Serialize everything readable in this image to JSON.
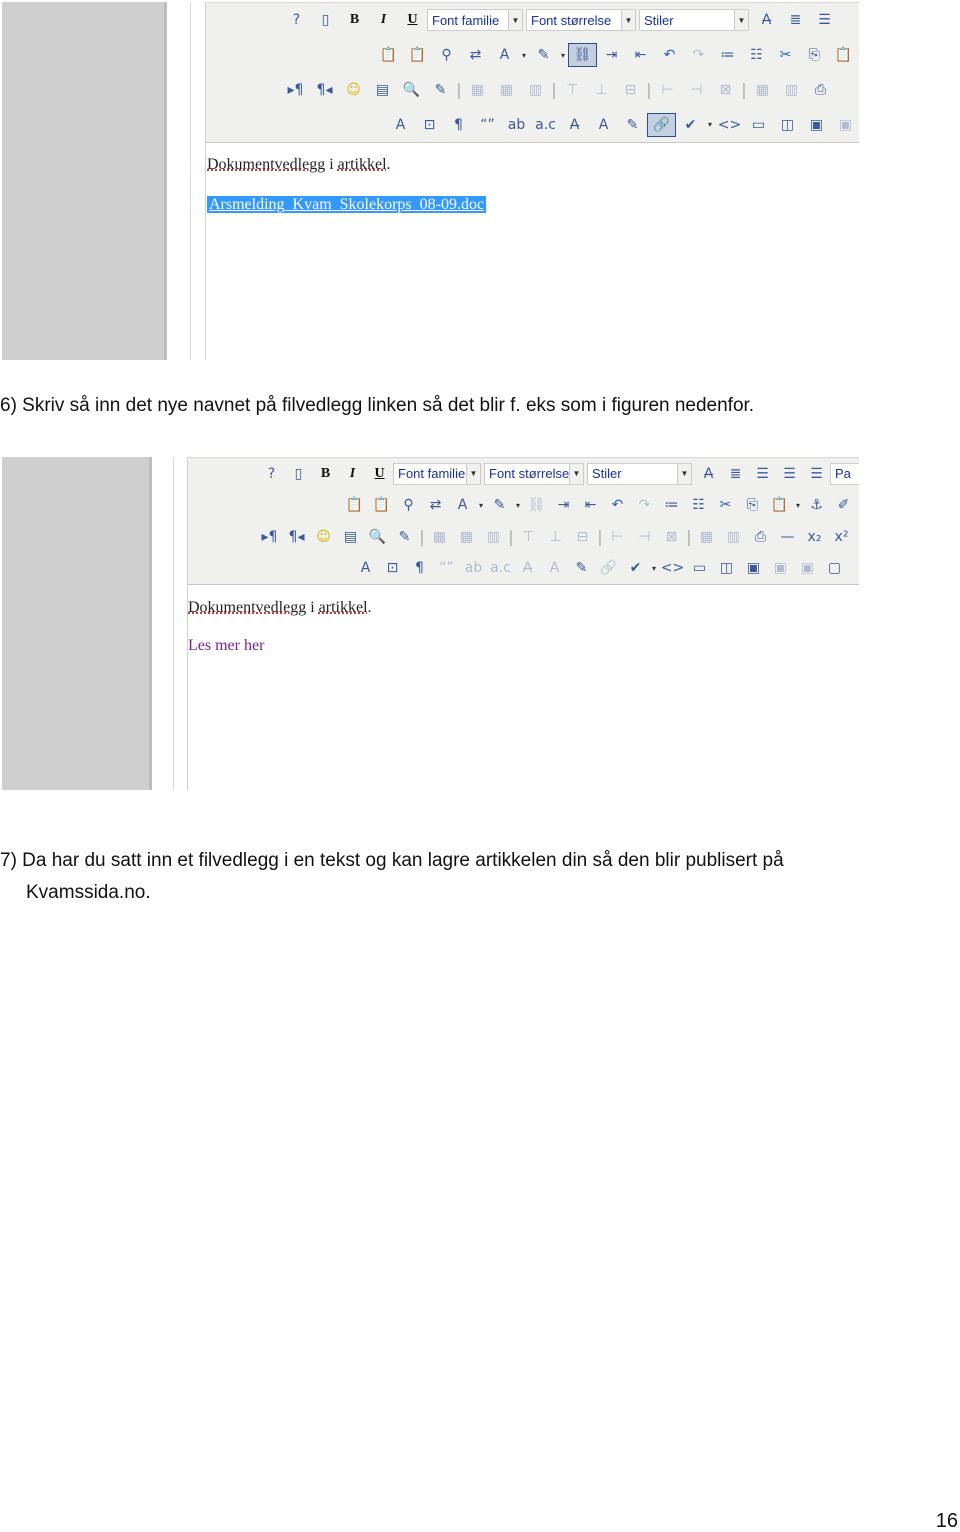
{
  "screenshot1": {
    "toolbar": {
      "font_family": "Font familie",
      "font_size": "Font størrelse",
      "styles": "Stiler",
      "rows": [
        [
          "help",
          "new-document",
          "bold",
          "italic",
          "underline",
          "SELECTS",
          "strikethrough-abc",
          "justify-full",
          "align-center"
        ],
        [
          "paste-word",
          "paste-text",
          "find",
          "replace",
          "text-color",
          "dropdown",
          "highlight-color",
          "dropdown",
          "unlink-active",
          "indent",
          "outdent",
          "undo",
          "redo-disabled",
          "ordered-list",
          "unordered-list",
          "cut",
          "copy",
          "paste"
        ],
        [
          "ltr",
          "rtl",
          "emoticon",
          "template",
          "preview",
          "edit-document",
          "separator",
          "row-props-disabled",
          "cell-props-disabled",
          "merge-disabled",
          "separator",
          "row-before-disabled",
          "row-after-disabled",
          "delete-row-disabled",
          "separator",
          "col-before-disabled",
          "col-after-disabled",
          "delete-col-disabled",
          "separator",
          "table-disabled",
          "split-disabled",
          "print"
        ],
        [
          "styleprops",
          "insert-layer",
          "pilcrow",
          "cite",
          "abbr",
          "acronym",
          "del",
          "ins",
          "attribs",
          "link-active",
          "spellcheck",
          "dropdown",
          "code",
          "layer",
          "columns",
          "image",
          "image-disabled"
        ]
      ]
    },
    "content": {
      "line1_word1": "Dokumentvedlegg",
      "line1_word2": "i",
      "line1_word3": "artikkel",
      "line1_end": ".",
      "link_text": "Arsmelding_Kvam_Skolekorps_08-09.doc"
    }
  },
  "caption6": "6) Skriv så inn det nye navnet på filvedlegg linken så det blir f. eks som i figuren nedenfor.",
  "screenshot2": {
    "toolbar": {
      "font_family": "Font familie",
      "font_size": "Font størrelse",
      "styles": "Stiler",
      "format_clipped": "Pa",
      "rows": [
        [
          "help",
          "new-document",
          "bold",
          "italic",
          "underline",
          "SELECTS",
          "strikethrough-abc",
          "justify-full",
          "align-center",
          "align-left",
          "align-right",
          "FORMAT"
        ],
        [
          "paste-word",
          "paste-text",
          "find",
          "replace",
          "text-color",
          "dropdown",
          "highlight-color",
          "dropdown",
          "unlink-disabled",
          "indent",
          "outdent",
          "undo",
          "redo-disabled",
          "ordered-list",
          "unordered-list",
          "cut",
          "copy",
          "paste",
          "dropdown",
          "anchor",
          "cleanup"
        ],
        [
          "ltr",
          "rtl",
          "emoticon",
          "template",
          "preview",
          "edit-document",
          "separator",
          "row-props-disabled",
          "cell-props-disabled",
          "merge-disabled",
          "separator",
          "row-before-disabled",
          "row-after-disabled",
          "delete-row-disabled",
          "separator",
          "col-before-disabled",
          "col-after-disabled",
          "delete-col-disabled",
          "separator",
          "table-disabled",
          "split-disabled",
          "print",
          "horizontal-rule",
          "subscript",
          "superscript"
        ],
        [
          "styleprops",
          "insert-layer",
          "pilcrow",
          "cite-disabled",
          "abbr-disabled",
          "acronym-disabled",
          "del-disabled",
          "ins-disabled",
          "attribs",
          "link-disabled",
          "spellcheck",
          "dropdown",
          "code",
          "layer",
          "columns",
          "image",
          "image-disabled",
          "image-disabled",
          "media"
        ]
      ]
    },
    "content": {
      "line1_word1": "Dokumentvedlegg",
      "line1_word2": "i",
      "line1_word3": "artikkel",
      "line1_end": ".",
      "link_text": "Les mer her"
    }
  },
  "caption7_line1": "7) Da har du satt inn et filvedlegg i en tekst og kan lagre artikkelen din så den blir publisert på",
  "caption7_line2": "Kvamssida.no.",
  "page_number": "16",
  "colors": {
    "selection": "#3399ff",
    "visited_link": "#7b1f8f",
    "toolbar_bg": "#f0f0ee",
    "select_text": "#1a2fa8"
  }
}
